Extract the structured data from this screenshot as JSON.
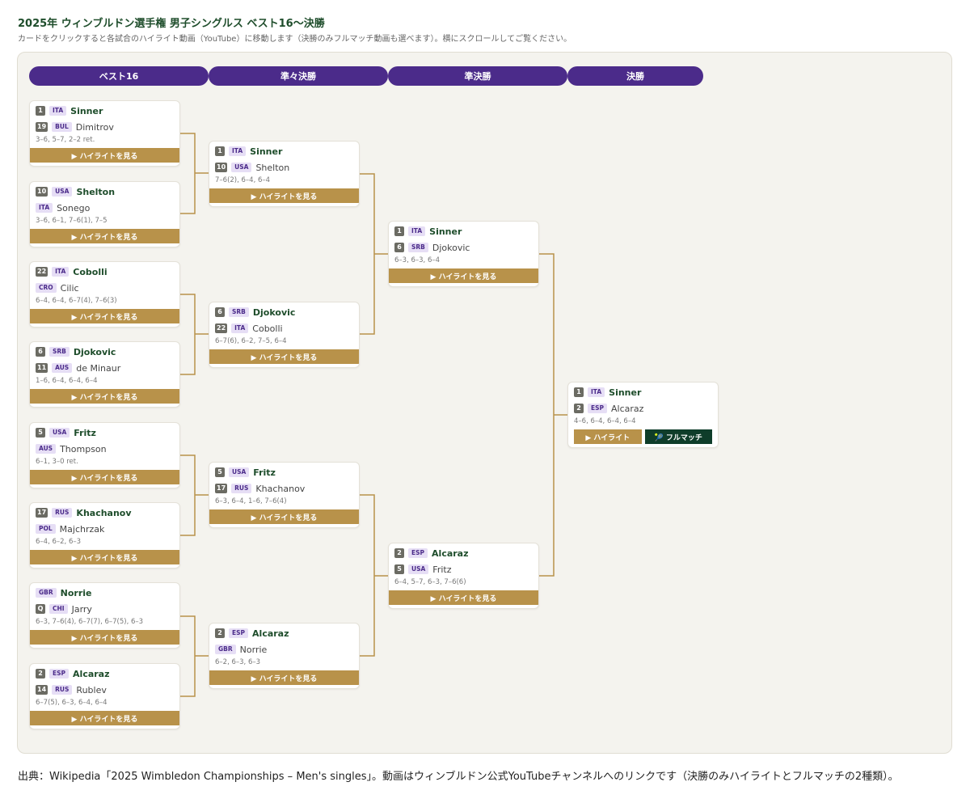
{
  "title": "2025年 ウィンブルドン選手権 男子シングルス ベスト16〜決勝",
  "subtitle": "カードをクリックすると各試合のハイライト動画（YouTube）に移動します（決勝のみフルマッチ動画も選べます）。横にスクロールしてご覧ください。",
  "rounds": [
    "ベスト16",
    "準々決勝",
    "準決勝",
    "決勝"
  ],
  "highlight_label": "▶ ハイライトを見る",
  "final_buttons": {
    "highlight": "▶ ハイライト",
    "full": "🎾 フルマッチ"
  },
  "matches": [
    {
      "p1": {
        "seed": "1",
        "cc": "ITA",
        "name": "Sinner"
      },
      "p2": {
        "seed": "19",
        "cc": "BUL",
        "name": "Dimitrov"
      },
      "score": "3–6, 5–7, 2–2 ret."
    },
    {
      "p1": {
        "seed": "10",
        "cc": "USA",
        "name": "Shelton"
      },
      "p2": {
        "seed": "",
        "cc": "ITA",
        "name": "Sonego"
      },
      "score": "3–6, 6–1, 7–6(1), 7–5"
    },
    {
      "p1": {
        "seed": "22",
        "cc": "ITA",
        "name": "Cobolli"
      },
      "p2": {
        "seed": "",
        "cc": "CRO",
        "name": "Cilic"
      },
      "score": "6–4, 6–4, 6–7(4), 7–6(3)"
    },
    {
      "p1": {
        "seed": "6",
        "cc": "SRB",
        "name": "Djokovic"
      },
      "p2": {
        "seed": "11",
        "cc": "AUS",
        "name": "de Minaur"
      },
      "score": "1–6, 6–4, 6–4, 6–4"
    },
    {
      "p1": {
        "seed": "5",
        "cc": "USA",
        "name": "Fritz"
      },
      "p2": {
        "seed": "",
        "cc": "AUS",
        "name": "Thompson"
      },
      "score": "6–1, 3–0 ret."
    },
    {
      "p1": {
        "seed": "17",
        "cc": "RUS",
        "name": "Khachanov"
      },
      "p2": {
        "seed": "",
        "cc": "POL",
        "name": "Majchrzak"
      },
      "score": "6–4, 6–2, 6–3"
    },
    {
      "p1": {
        "seed": "",
        "cc": "GBR",
        "name": "Norrie"
      },
      "p2": {
        "seed": "Q",
        "cc": "CHI",
        "name": "Jarry"
      },
      "score": "6–3, 7–6(4), 6–7(7), 6–7(5), 6–3"
    },
    {
      "p1": {
        "seed": "2",
        "cc": "ESP",
        "name": "Alcaraz"
      },
      "p2": {
        "seed": "14",
        "cc": "RUS",
        "name": "Rublev"
      },
      "score": "6–7(5), 6–3, 6–4, 6–4"
    },
    {
      "p1": {
        "seed": "1",
        "cc": "ITA",
        "name": "Sinner"
      },
      "p2": {
        "seed": "10",
        "cc": "USA",
        "name": "Shelton"
      },
      "score": "7–6(2), 6–4, 6–4"
    },
    {
      "p1": {
        "seed": "6",
        "cc": "SRB",
        "name": "Djokovic"
      },
      "p2": {
        "seed": "22",
        "cc": "ITA",
        "name": "Cobolli"
      },
      "score": "6–7(6), 6–2, 7–5, 6–4"
    },
    {
      "p1": {
        "seed": "5",
        "cc": "USA",
        "name": "Fritz"
      },
      "p2": {
        "seed": "17",
        "cc": "RUS",
        "name": "Khachanov"
      },
      "score": "6–3, 6–4, 1–6, 7–6(4)"
    },
    {
      "p1": {
        "seed": "2",
        "cc": "ESP",
        "name": "Alcaraz"
      },
      "p2": {
        "seed": "",
        "cc": "GBR",
        "name": "Norrie"
      },
      "score": "6–2, 6–3, 6–3"
    },
    {
      "p1": {
        "seed": "1",
        "cc": "ITA",
        "name": "Sinner"
      },
      "p2": {
        "seed": "6",
        "cc": "SRB",
        "name": "Djokovic"
      },
      "score": "6–3, 6–3, 6–4"
    },
    {
      "p1": {
        "seed": "2",
        "cc": "ESP",
        "name": "Alcaraz"
      },
      "p2": {
        "seed": "5",
        "cc": "USA",
        "name": "Fritz"
      },
      "score": "6–4, 5–7, 6–3, 7–6(6)"
    },
    {
      "p1": {
        "seed": "1",
        "cc": "ITA",
        "name": "Sinner"
      },
      "p2": {
        "seed": "2",
        "cc": "ESP",
        "name": "Alcaraz"
      },
      "score": "4–6, 6–4, 6–4, 6–4"
    }
  ],
  "footer": "出典：Wikipedia「2025 Wimbledon Championships – Men's singles」。動画はウィンブルドン公式YouTubeチャンネルへのリンクです（決勝のみハイライトとフルマッチの2種類）。",
  "colors": {
    "header": "#4b2b8a",
    "gold": "#b8924a",
    "green": "#0f3d2a",
    "winner": "#1e4d2b"
  }
}
